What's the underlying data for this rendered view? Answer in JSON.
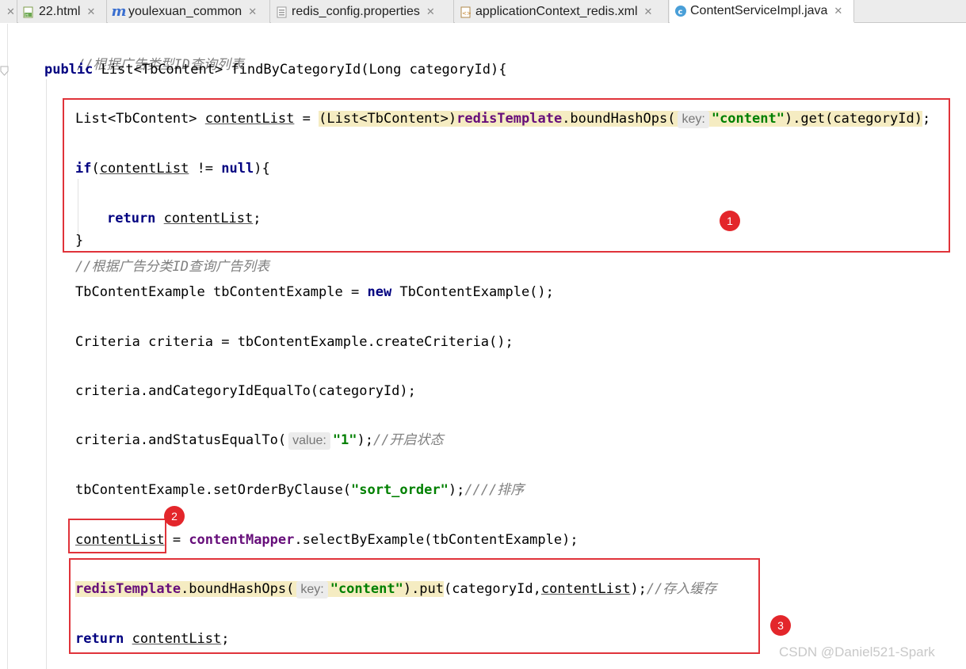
{
  "tabs": [
    {
      "label": "22.html",
      "icon": "html-file-icon",
      "active": false
    },
    {
      "label": "youlexuan_common",
      "icon": "maven-module-icon",
      "active": false
    },
    {
      "label": "redis_config.properties",
      "icon": "properties-file-icon",
      "active": false
    },
    {
      "label": "applicationContext_redis.xml",
      "icon": "xml-file-icon",
      "active": false
    },
    {
      "label": "ContentServiceImpl.java",
      "icon": "java-class-icon",
      "active": true
    }
  ],
  "code": {
    "comment1": "//根据广告类型ID查询列表",
    "sig": {
      "kw": "public",
      "type": "List<TbContent>",
      "rest": "findByCategoryId(Long categoryId){"
    },
    "l1": {
      "type": "List<TbContent>",
      "var": "contentList",
      "eq": "=",
      "cast": "(List<TbContent>)",
      "field": "redisTemplate",
      "call": ".boundHashOps(",
      "hint": "key:",
      "str": "\"content\"",
      "tail": ").get(categoryId)",
      "semi": ";"
    },
    "l2": {
      "kw": "if",
      "open": "(",
      "var": "contentList",
      "op": " != ",
      "kwnull": "null",
      "close": "){"
    },
    "l3": {
      "kw": "return",
      "var": "contentList",
      "semi": ";"
    },
    "l4": "}",
    "comment2": "//根据广告分类ID查询广告列表",
    "l5": {
      "pre": "TbContentExample tbContentExample = ",
      "kw": "new",
      "post": " TbContentExample();"
    },
    "l6": "Criteria criteria = tbContentExample.createCriteria();",
    "l7": "criteria.andCategoryIdEqualTo(categoryId);",
    "l8": {
      "pre": "criteria.andStatusEqualTo(",
      "hint": "value:",
      "str": "\"1\"",
      "post": ");",
      "comment": "//开启状态"
    },
    "l9": {
      "pre": "tbContentExample.setOrderByClause(",
      "str": "\"sort_order\"",
      "post": ");",
      "comment": "////排序"
    },
    "l10": {
      "var": "contentList",
      "eq": " = ",
      "field": "contentMapper",
      "post": ".selectByExample(tbContentExample);"
    },
    "l11": {
      "field": "redisTemplate",
      "call": ".boundHashOps(",
      "hint": "key:",
      "str": "\"content\"",
      "put": ").put",
      "args_open": "(categoryId,",
      "var": "contentList",
      "post": ");",
      "comment": "//存入缓存"
    },
    "l12": {
      "kw": "return",
      "var": "contentList",
      "semi": ";"
    }
  },
  "annotations": [
    {
      "label": "1",
      "color": "#e3262b"
    },
    {
      "label": "2",
      "color": "#e3262b"
    },
    {
      "label": "3",
      "color": "#e3262b"
    }
  ],
  "watermark": "CSDN @Daniel521-Spark"
}
